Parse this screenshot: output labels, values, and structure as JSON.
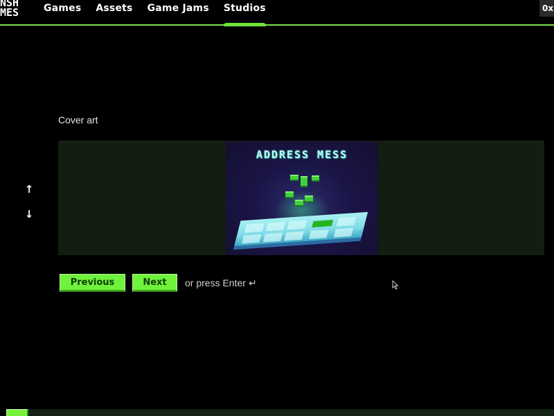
{
  "nav": {
    "logo_lines": [
      "NSH",
      "MES"
    ],
    "items": [
      {
        "label": "Games",
        "active": false
      },
      {
        "label": "Assets",
        "active": false
      },
      {
        "label": "Game Jams",
        "active": false
      },
      {
        "label": "Studios",
        "active": true
      }
    ],
    "corner_badge": "0x"
  },
  "editor": {
    "section_label": "Cover art",
    "move_up_icon": "arrow-up-icon",
    "move_down_icon": "arrow-down-icon",
    "cover_image": {
      "title_text": "ADDRESS MESS",
      "description": "Pixel-art cover showing green blocks falling onto a cyan grid board"
    },
    "buttons": {
      "previous": "Previous",
      "next": "Next"
    },
    "hint_text": "or press Enter",
    "hint_icon": "↵"
  },
  "progress": {
    "percent": 4
  },
  "colors": {
    "accent_green": "#6ff23b",
    "panel_bg": "#121e12",
    "page_bg": "#000000"
  }
}
